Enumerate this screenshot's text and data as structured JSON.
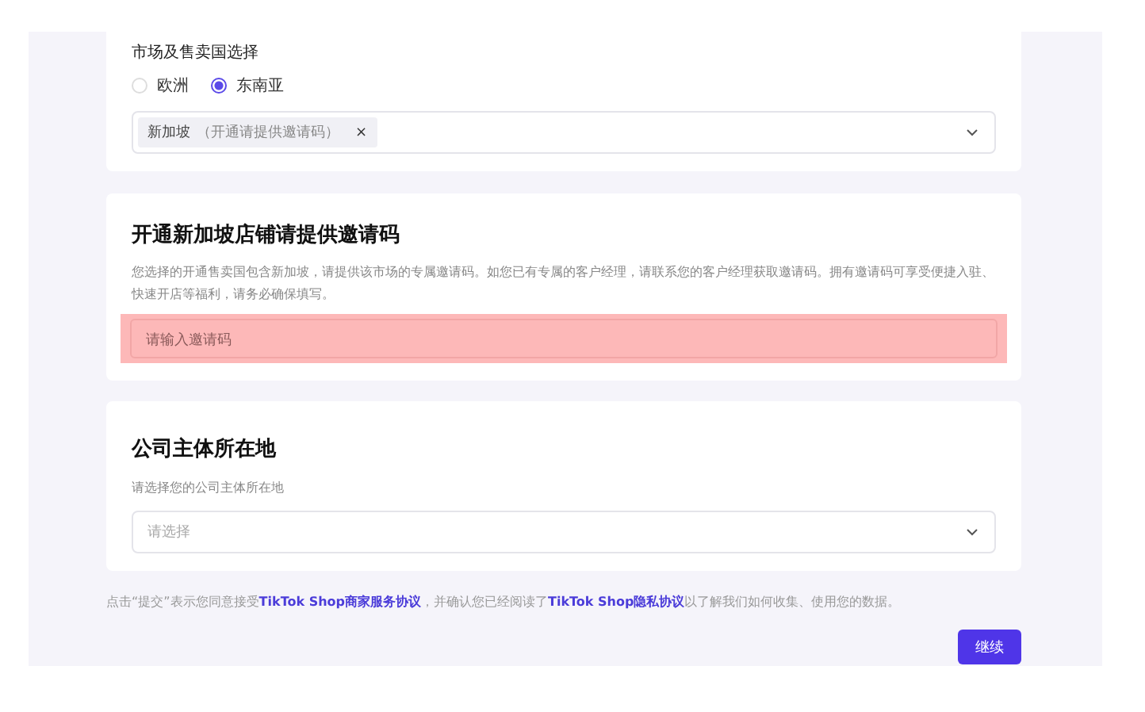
{
  "market_section": {
    "label": "市场及售卖国选择",
    "regions": [
      {
        "label": "欧洲",
        "selected": false
      },
      {
        "label": "东南亚",
        "selected": true
      }
    ],
    "tags": [
      {
        "label": "新加坡",
        "note": "（开通请提供邀请码）",
        "remove": "×"
      }
    ]
  },
  "invite_section": {
    "title": "开通新加坡店铺请提供邀请码",
    "description": "您选择的开通售卖国包含新加坡，请提供该市场的专属邀请码。如您已有专属的客户经理，请联系您的客户经理获取邀请码。拥有邀请码可享受便捷入驻、快速开店等福利，请务必确保填写。",
    "placeholder": "请输入邀请码",
    "highlighted": true
  },
  "company_section": {
    "title": "公司主体所在地",
    "subtitle": "请选择您的公司主体所在地",
    "placeholder": "请选择"
  },
  "agreement": {
    "parts": [
      {
        "kind": "text",
        "text": "点击“提交”表示您同意接受"
      },
      {
        "kind": "link",
        "text": "TikTok Shop商家服务协议"
      },
      {
        "kind": "text",
        "text": "，并确认您已经阅读了"
      },
      {
        "kind": "link",
        "text": "TikTok Shop隐私协议"
      },
      {
        "kind": "text",
        "text": "以了解我们如何收集、使用您的数据。"
      }
    ]
  },
  "continue_button": "继续"
}
